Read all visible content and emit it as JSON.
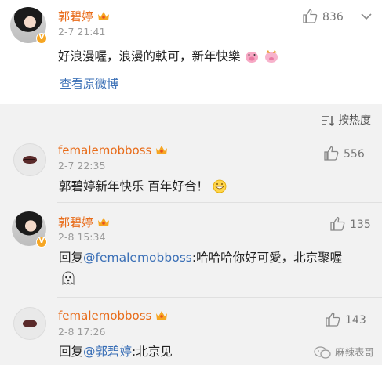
{
  "post": {
    "author": "郭碧婷",
    "time": "2-7 21:41",
    "likes": "836",
    "text": "好浪漫喔，浪漫的軼可，新年快樂",
    "view_original": "查看原微博"
  },
  "sort": {
    "label": "按热度"
  },
  "comments": [
    {
      "author": "femalemobboss",
      "time": "2-7 22:35",
      "likes": "556",
      "text": "郭碧婷新年快乐 百年好合！"
    },
    {
      "author": "郭碧婷",
      "time": "2-8 15:34",
      "likes": "135",
      "reply_prefix": "回复",
      "mention": "@femalemobboss",
      "text": ":哈哈哈你好可愛，北京聚喔"
    },
    {
      "author": "femalemobboss",
      "time": "2-8 17:26",
      "likes": "143",
      "reply_prefix": "回复",
      "mention": "@郭碧婷",
      "text": ":北京见"
    }
  ],
  "watermark": "麻辣表哥",
  "icons": [
    "thumb-up-icon",
    "chevron-down-icon",
    "sort-icon",
    "verified-badge-icon",
    "crown-badge-icon",
    "wechat-icon"
  ]
}
